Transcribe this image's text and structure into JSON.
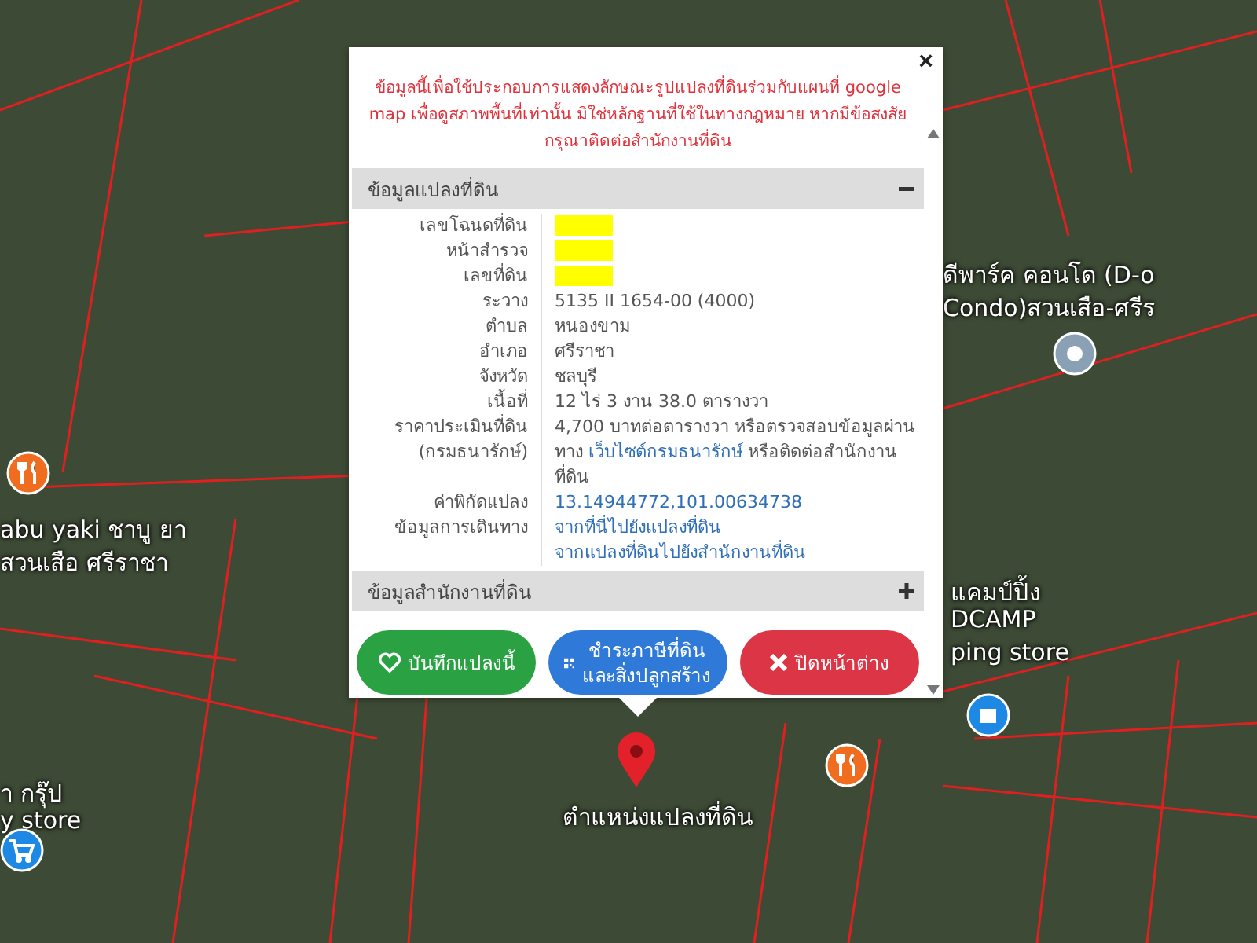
{
  "map": {
    "labels": [
      {
        "text": "ดีพาร์ค คอนโด (D-o"
      },
      {
        "text": "Condo)สวนเสือ-ศรีร"
      },
      {
        "text": "abu yaki ชาบู ยา"
      },
      {
        "text": "สวนเสือ ศรีราชา"
      },
      {
        "text": "า กรุ๊ป"
      },
      {
        "text": "y store"
      },
      {
        "text": "แคมป์ปิ้ง"
      },
      {
        "text": "DCAMP"
      },
      {
        "text": "ping store"
      },
      {
        "text": "ตำแหน่งแปลงที่ดิน"
      }
    ],
    "markers": [
      {
        "kind": "food",
        "color": "#f06c1e"
      },
      {
        "kind": "cart",
        "color": "#1e88e5"
      },
      {
        "kind": "place",
        "color": "#8aa0b4"
      },
      {
        "kind": "food",
        "color": "#f06c1e"
      },
      {
        "kind": "shop",
        "color": "#1e88e5"
      }
    ]
  },
  "popup": {
    "notice": "ข้อมูลนี้เพื่อใช้ประกอบการแสดงลักษณะรูปแปลงที่ดินร่วมกับแผนที่ google map เพื่อดูสภาพพื้นที่เท่านั้น มิใช่หลักฐานที่ใช้ในทางกฎหมาย หากมีข้อสงสัย กรุณาติดต่อสำนักงานที่ดิน",
    "sections": [
      {
        "title": "ข้อมูลแปลงที่ดิน",
        "expanded": true,
        "rows": [
          {
            "label": "เลขโฉนดที่ดิน",
            "kind": "redacted"
          },
          {
            "label": "หน้าสำรวจ",
            "kind": "redacted"
          },
          {
            "label": "เลขที่ดิน",
            "kind": "redacted"
          },
          {
            "label": "ระวาง",
            "kind": "text",
            "parts": [
              {
                "text": "5135 II 1654-00 (4000)",
                "link": false
              }
            ]
          },
          {
            "label": "ตำบล",
            "kind": "text",
            "parts": [
              {
                "text": "หนองขาม",
                "link": false
              }
            ]
          },
          {
            "label": "อำเภอ",
            "kind": "text",
            "parts": [
              {
                "text": "ศรีราชา",
                "link": false
              }
            ]
          },
          {
            "label": "จังหวัด",
            "kind": "text",
            "parts": [
              {
                "text": "ชลบุรี",
                "link": false
              }
            ]
          },
          {
            "label": "เนื้อที่",
            "kind": "text",
            "parts": [
              {
                "text": "12 ไร่ 3 งาน 38.0 ตารางวา",
                "link": false
              }
            ]
          },
          {
            "label": "ราคาประเมินที่ดิน (กรมธนารักษ์)",
            "kind": "text",
            "parts": [
              {
                "text": "4,700 บาทต่อตารางวา หรือตรวจสอบข้อมูลผ่านทาง ",
                "link": false
              },
              {
                "text": "เว็บไซต์กรมธนารักษ์",
                "link": true
              },
              {
                "text": " หรือติดต่อสำนักงานที่ดิน",
                "link": false
              }
            ]
          },
          {
            "label": "ค่าพิกัดแปลง",
            "kind": "links",
            "parts": [
              {
                "text": "13.14944772,101.00634738",
                "link": true
              }
            ]
          },
          {
            "label": "ข้อมูลการเดินทาง",
            "kind": "links",
            "parts": [
              {
                "text": "จากที่นี่ไปยังแปลงที่ดิน",
                "link": true
              },
              {
                "text": "จากแปลงที่ดินไปยังสำนักงานที่ดิน",
                "link": true
              }
            ]
          }
        ]
      },
      {
        "title": "ข้อมูลสำนักงานที่ดิน",
        "expanded": false
      }
    ],
    "buttons": [
      {
        "label": "บันทึกแปลงนี้",
        "kind": "heart",
        "color": "#2aa243"
      },
      {
        "label": "ชำระภาษีที่ดินและสิ่งปลูกสร้าง",
        "kind": "qr",
        "color": "#2f7ad8"
      },
      {
        "label": "ปิดหน้าต่าง",
        "kind": "close",
        "color": "#dc3545"
      }
    ],
    "close": "×"
  }
}
